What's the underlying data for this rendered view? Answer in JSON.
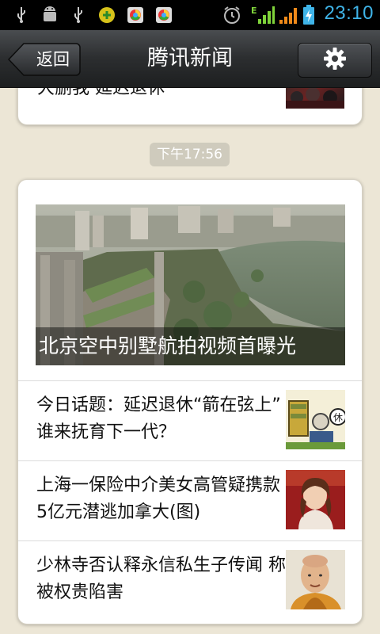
{
  "status_bar": {
    "time": "23:10",
    "icons": [
      "usb-icon",
      "android-debug-icon",
      "usb-icon",
      "app-notification-icon",
      "chrome-icon",
      "chrome-icon",
      "alarm-icon",
      "signal-e-icon",
      "signal-icon",
      "battery-charging-icon"
    ]
  },
  "header": {
    "back_label": "返回",
    "title": "腾讯新闻",
    "settings_icon": "gear-icon"
  },
  "previous_card": {
    "partial_text": "大删我 延迟退休",
    "thumbnail": "crowd-photo"
  },
  "timestamp": "下午17:56",
  "main_card": {
    "hero": {
      "caption": "北京空中别墅航拍视频首曝光",
      "image": "aerial-rooftop-villa-photo"
    },
    "items": [
      {
        "title": "今日话题：延迟退休“箭在弦上” 谁来抚育下一代？",
        "thumbnail": "cartoon-illustration"
      },
      {
        "title": "上海一保险中介美女高管疑携款5亿元潜逃加拿大(图)",
        "thumbnail": "woman-portrait"
      },
      {
        "title": "少林寺否认释永信私生子传闻 称被权贵陷害",
        "thumbnail": "monk-portrait"
      }
    ]
  },
  "colors": {
    "background": "#ece6d6",
    "titlebar": "#2c2e30",
    "time_accent": "#3fb4e8",
    "signal_green": "#7fd33a",
    "signal_orange": "#f08a1a"
  }
}
